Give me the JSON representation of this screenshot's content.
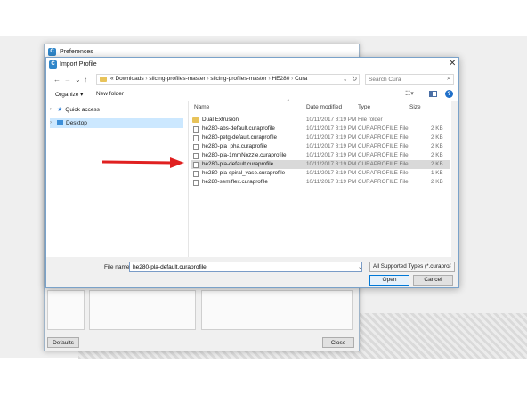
{
  "preferences": {
    "title": "Preferences",
    "defaults_label": "Defaults",
    "close_label": "Close"
  },
  "dialog": {
    "title": "Import Profile",
    "breadcrumb": [
      "Downloads",
      "slicing-profiles-master",
      "slicing-profiles-master",
      "HE280",
      "Cura"
    ],
    "breadcrumb_prefix": "«",
    "search_placeholder": "Search Cura",
    "organize_label": "Organize ▾",
    "new_folder_label": "New folder"
  },
  "nav": {
    "items": [
      {
        "label": "Quick access"
      },
      {
        "label": "Desktop"
      }
    ]
  },
  "columns": {
    "name": "Name",
    "date": "Date modified",
    "type": "Type",
    "size": "Size"
  },
  "files": [
    {
      "name": "Dual Extrusion",
      "date": "10/11/2017 8:19 PM",
      "type": "File folder",
      "size": "",
      "kind": "folder"
    },
    {
      "name": "he280-abs-default.curaprofile",
      "date": "10/11/2017 8:19 PM",
      "type": "CURAPROFILE File",
      "size": "2 KB",
      "kind": "file"
    },
    {
      "name": "he280-petg-default.curaprofile",
      "date": "10/11/2017 8:19 PM",
      "type": "CURAPROFILE File",
      "size": "2 KB",
      "kind": "file"
    },
    {
      "name": "he280-pla_pha.curaprofile",
      "date": "10/11/2017 8:19 PM",
      "type": "CURAPROFILE File",
      "size": "2 KB",
      "kind": "file"
    },
    {
      "name": "he280-pla-1mmNozzle.curaprofile",
      "date": "10/11/2017 8:19 PM",
      "type": "CURAPROFILE File",
      "size": "2 KB",
      "kind": "file"
    },
    {
      "name": "he280-pla-default.curaprofile",
      "date": "10/11/2017 8:19 PM",
      "type": "CURAPROFILE File",
      "size": "2 KB",
      "kind": "file",
      "selected": true
    },
    {
      "name": "he280-pla-spiral_vase.curaprofile",
      "date": "10/11/2017 8:19 PM",
      "type": "CURAPROFILE File",
      "size": "1 KB",
      "kind": "file"
    },
    {
      "name": "he280-semiflex.curaprofile",
      "date": "10/11/2017 8:19 PM",
      "type": "CURAPROFILE File",
      "size": "2 KB",
      "kind": "file"
    }
  ],
  "bottom": {
    "filename_label": "File name:",
    "filename_value": "he280-pla-default.curaprofile",
    "filetype_value": "All Supported Types (*.curaprof",
    "open_label": "Open",
    "cancel_label": "Cancel"
  },
  "colors": {
    "accent": "#0078d7",
    "selection": "#d9d9d9",
    "arrow": "#e02020",
    "folder": "#e8c35a"
  }
}
